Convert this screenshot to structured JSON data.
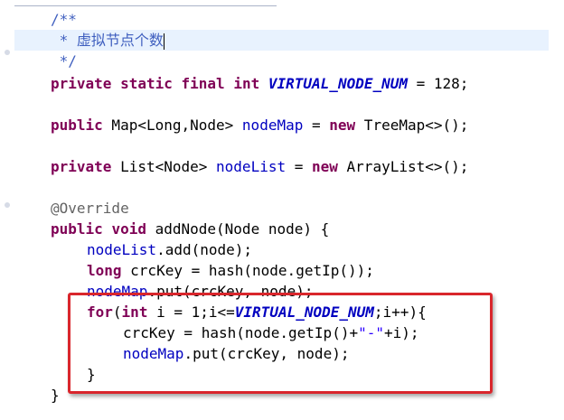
{
  "editor": {
    "lines": [
      [
        {
          "t": "/**",
          "c": "comment"
        }
      ],
      [
        {
          "t": " * 虚拟节点个数",
          "c": "comment"
        }
      ],
      [
        {
          "t": " */",
          "c": "comment"
        }
      ],
      [
        {
          "t": "private",
          "c": "kw"
        },
        {
          "t": " ",
          "c": "plain"
        },
        {
          "t": "static",
          "c": "kw"
        },
        {
          "t": " ",
          "c": "plain"
        },
        {
          "t": "final",
          "c": "kw"
        },
        {
          "t": " ",
          "c": "plain"
        },
        {
          "t": "int",
          "c": "kw"
        },
        {
          "t": " ",
          "c": "plain"
        },
        {
          "t": "VIRTUAL_NODE_NUM",
          "c": "const"
        },
        {
          "t": " = 128;",
          "c": "plain"
        }
      ],
      [],
      [
        {
          "t": "public",
          "c": "kw"
        },
        {
          "t": " Map<Long,Node> ",
          "c": "plain"
        },
        {
          "t": "nodeMap",
          "c": "field"
        },
        {
          "t": " = ",
          "c": "plain"
        },
        {
          "t": "new",
          "c": "kw"
        },
        {
          "t": " TreeMap<>();",
          "c": "plain"
        }
      ],
      [],
      [
        {
          "t": "private",
          "c": "kw"
        },
        {
          "t": " List<Node> ",
          "c": "plain"
        },
        {
          "t": "nodeList",
          "c": "field"
        },
        {
          "t": " = ",
          "c": "plain"
        },
        {
          "t": "new",
          "c": "kw"
        },
        {
          "t": " ArrayList<>();",
          "c": "plain"
        }
      ],
      [],
      [
        {
          "t": "@Override",
          "c": "anno"
        }
      ],
      [
        {
          "t": "public",
          "c": "kw"
        },
        {
          "t": " ",
          "c": "plain"
        },
        {
          "t": "void",
          "c": "kw"
        },
        {
          "t": " addNode(Node node) {",
          "c": "plain"
        }
      ],
      [
        {
          "t": "nodeList",
          "c": "field"
        },
        {
          "t": ".add(node);",
          "c": "plain"
        }
      ],
      [
        {
          "t": "long",
          "c": "kw"
        },
        {
          "t": " crcKey = hash(node.getIp());",
          "c": "plain"
        }
      ],
      [
        {
          "t": "nodeMap",
          "c": "field"
        },
        {
          "t": ".put(crcKey, node);",
          "c": "plain"
        }
      ],
      [
        {
          "t": "for",
          "c": "kw"
        },
        {
          "t": "(",
          "c": "plain"
        },
        {
          "t": "int",
          "c": "kw"
        },
        {
          "t": " i = 1;i<=",
          "c": "plain"
        },
        {
          "t": "VIRTUAL_NODE_NUM",
          "c": "const"
        },
        {
          "t": ";i++){",
          "c": "plain"
        }
      ],
      [
        {
          "t": "crcKey = hash(node.getIp()+",
          "c": "plain"
        },
        {
          "t": "\"-\"",
          "c": "str"
        },
        {
          "t": "+i);",
          "c": "plain"
        }
      ],
      [
        {
          "t": "nodeMap",
          "c": "field"
        },
        {
          "t": ".put(crcKey, node);",
          "c": "plain"
        }
      ],
      [
        {
          "t": "}",
          "c": "plain"
        }
      ],
      [
        {
          "t": "}",
          "c": "plain"
        }
      ]
    ]
  },
  "annotation": {
    "box_color": "#d9262c",
    "label": "highlighted virtual node loop"
  }
}
